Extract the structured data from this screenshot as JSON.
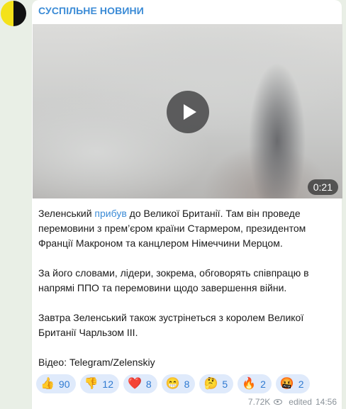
{
  "channel": {
    "name": "СУСПІЛЬНЕ НОВИНИ"
  },
  "video": {
    "duration": "0:21"
  },
  "message": {
    "p1_before": "Зеленський ",
    "p1_link": "прибув",
    "p1_after": " до Великої Британії. Там він проведе перемовини з прем’єром країни Стармером, президентом Франції Макроном та канцлером Німеччини Мерцом.",
    "p2": "За його словами, лідери, зокрема, обговорять співпрацю в напрямі ППО та перемовини щодо завершення війни.",
    "p3": "Завтра Зеленський також зустрінеться з королем Великої Британії Чарльзом ІІІ.",
    "p4": "Відео: Telegram/Zelenskiy"
  },
  "reactions": [
    {
      "emoji": "👍",
      "count": "90"
    },
    {
      "emoji": "👎",
      "count": "12"
    },
    {
      "emoji": "❤️",
      "count": "8"
    },
    {
      "emoji": "😁",
      "count": "8"
    },
    {
      "emoji": "🤔",
      "count": "5"
    },
    {
      "emoji": "🔥",
      "count": "2"
    },
    {
      "emoji": "🤬",
      "count": "2"
    }
  ],
  "footer": {
    "views": "7.72K",
    "edited": "edited",
    "time": "14:56"
  },
  "colors": {
    "accent": "#3b8bd6",
    "reaction_bg": "#dfeafb",
    "background": "#e9efe6"
  },
  "icons": {
    "play": "play-icon",
    "views": "eye-icon"
  }
}
